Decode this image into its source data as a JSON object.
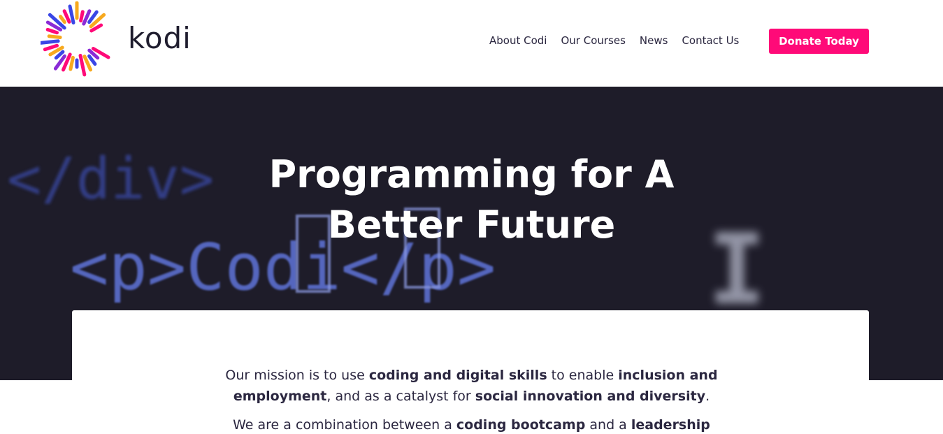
{
  "brand": {
    "logo_text": "kodi",
    "colors": {
      "pink": "#ff0a78",
      "orange": "#f7a91e",
      "blue": "#3a46e6",
      "purple": "#8a2bd6",
      "dark": "#1e1c29"
    }
  },
  "nav": {
    "items": [
      {
        "label": "About Codi"
      },
      {
        "label": "Our Courses"
      },
      {
        "label": "News"
      },
      {
        "label": "Contact Us"
      }
    ],
    "donate_label": "Donate Today"
  },
  "hero": {
    "title": "Programming for A Better Future",
    "background_code": {
      "line1": "</div>",
      "line2": "<p>Codi</p>",
      "cursor": "I"
    }
  },
  "mission": {
    "p1_a": "Our mission is to use ",
    "p1_b": "coding and digital skills",
    "p1_c": " to enable ",
    "p1_d": "inclusion and employment",
    "p1_e": ", and as a catalyst for ",
    "p1_f": "social innovation and diversity",
    "p1_g": ".",
    "p2_a": "We are a combination between a ",
    "p2_b": "coding bootcamp",
    "p2_c": " and a ",
    "p2_d": "leadership"
  }
}
